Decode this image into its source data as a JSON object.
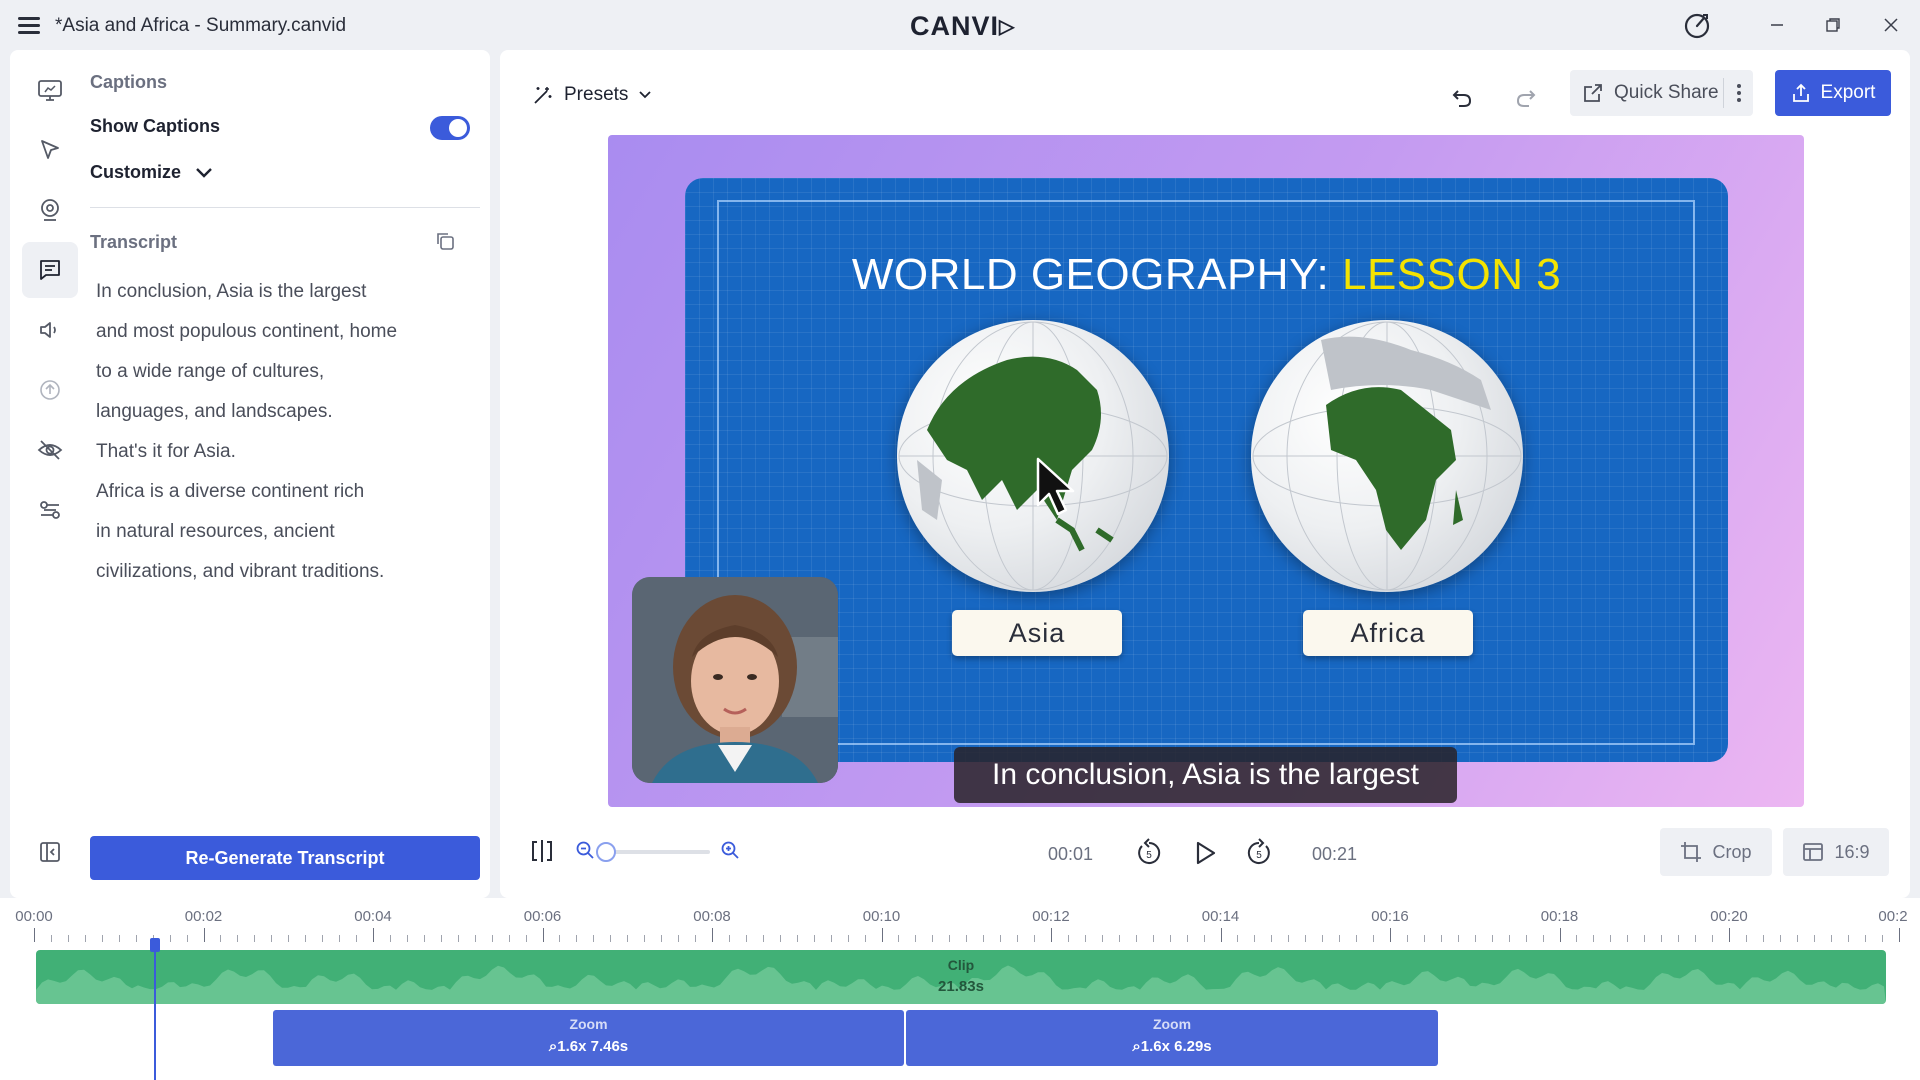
{
  "app": {
    "title": "*Asia and Africa - Summary.canvid",
    "logo": "CANVI"
  },
  "left_panel": {
    "section_title": "Captions",
    "show_captions_label": "Show Captions",
    "show_captions_on": true,
    "customize_label": "Customize",
    "transcript_title": "Transcript",
    "transcript_lines": [
      "In conclusion, Asia is the largest",
      "and most populous continent, home",
      "to a wide range of cultures,",
      "languages, and landscapes.",
      "That's it for Asia.",
      "Africa is a diverse continent rich",
      "in natural resources, ancient",
      "civilizations, and vibrant traditions."
    ],
    "regenerate_label": "Re-Generate Transcript",
    "rail_icons": [
      "screen-icon",
      "cursor-icon",
      "webcam-icon",
      "captions-icon",
      "audio-icon",
      "upload-icon",
      "hide-icon",
      "effects-icon"
    ]
  },
  "toolbar": {
    "presets_label": "Presets",
    "quick_share_label": "Quick Share",
    "export_label": "Export"
  },
  "preview": {
    "slide_title_main": "WORLD GEOGRAPHY:",
    "slide_title_highlight": "LESSON 3",
    "label_left": "Asia",
    "label_right": "Africa",
    "caption": "In conclusion, Asia is the largest"
  },
  "player": {
    "current_time": "00:01",
    "total_time": "00:21",
    "crop_label": "Crop",
    "aspect_label": "16:9",
    "zoom_level": 0.1
  },
  "timeline": {
    "ticks": [
      "00:00",
      "00:02",
      "00:04",
      "00:06",
      "00:08",
      "00:10",
      "00:12",
      "00:14",
      "00:16",
      "00:18",
      "00:20",
      "00:2"
    ],
    "clip": {
      "title": "Clip",
      "duration": "21.83s"
    },
    "zooms": [
      {
        "title": "Zoom",
        "info": "1.6x  7.46s"
      },
      {
        "title": "Zoom",
        "info": "1.6x  6.29s"
      }
    ]
  },
  "colors": {
    "accent": "#3b5bdb",
    "clip": "#41b076",
    "zoom": "#4b67d8",
    "slide_bg": "#1767c2",
    "highlight": "#f4e300"
  }
}
